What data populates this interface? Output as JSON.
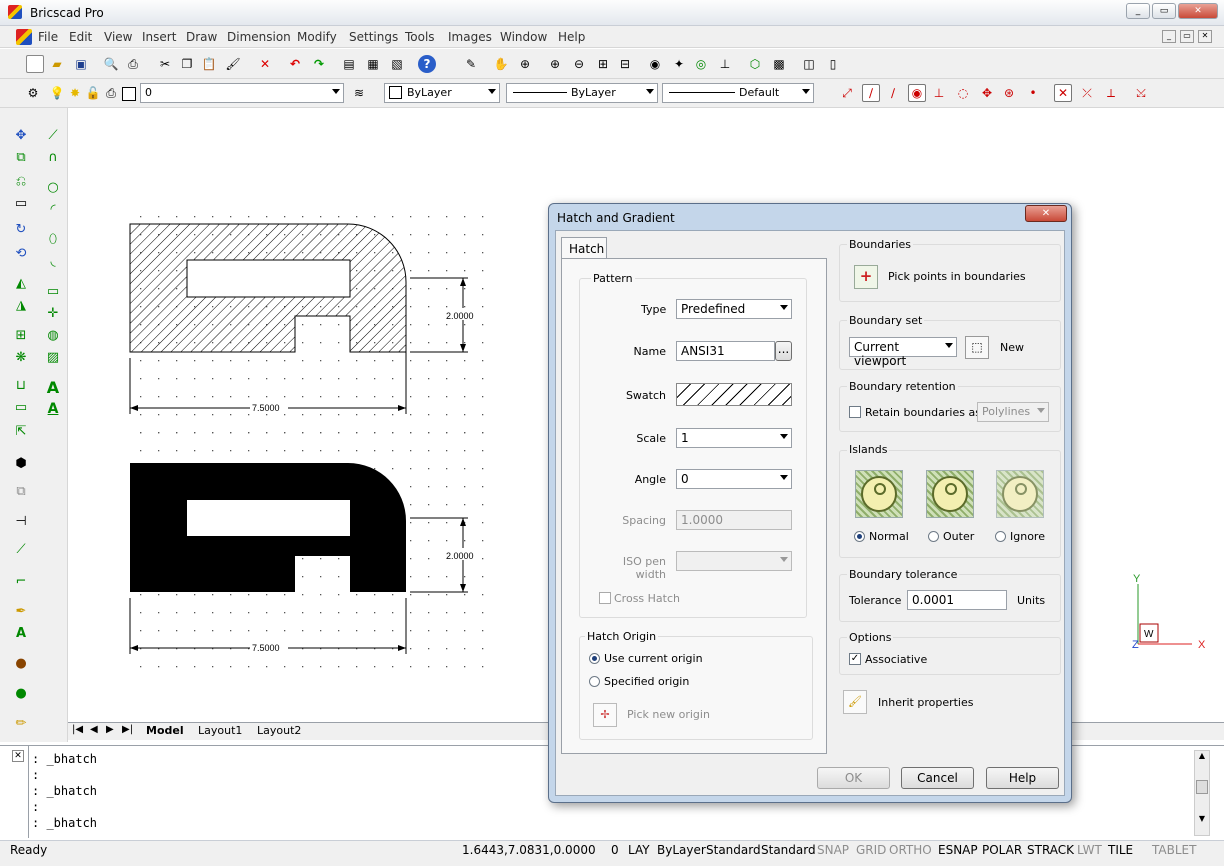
{
  "app": {
    "title": "Bricscad Pro"
  },
  "menu": [
    "File",
    "Edit",
    "View",
    "Insert",
    "Draw",
    "Dimension",
    "Modify",
    "Settings",
    "Tools",
    "Images",
    "Window",
    "Help"
  ],
  "props": {
    "layer": "0",
    "color": "ByLayer",
    "linetype": "ByLayer",
    "lineweight": "Default"
  },
  "drawing": {
    "dim_height_top": "2.0000",
    "dim_width_top": "7.5000",
    "dim_height_bottom": "2.0000",
    "dim_width_bottom": "7.5000"
  },
  "ucs": {
    "y": "Y",
    "x": "X",
    "z": "Z",
    "w": "W"
  },
  "layout_tabs": [
    "Model",
    "Layout1",
    "Layout2"
  ],
  "command_lines": [
    ": _bhatch",
    ":",
    ": _bhatch",
    ":",
    ": _bhatch"
  ],
  "status": {
    "ready": "Ready",
    "coords": "1.6443,7.0831,0.0000",
    "layer_num": "0",
    "items": [
      "LAY",
      "ByLayer",
      "Standard",
      "Standard",
      "SNAP",
      "GRID",
      "ORTHO",
      "ESNAP",
      "POLAR",
      "STRACK",
      "LWT",
      "TILE",
      "TABLET"
    ]
  },
  "dialog": {
    "title": "Hatch and Gradient",
    "tab": "Hatch",
    "pattern_group": "Pattern",
    "type_label": "Type",
    "type_value": "Predefined",
    "name_label": "Name",
    "name_value": "ANSI31",
    "browse": "...",
    "swatch_label": "Swatch",
    "scale_label": "Scale",
    "scale_value": "1",
    "angle_label": "Angle",
    "angle_value": "0",
    "spacing_label": "Spacing",
    "spacing_value": "1.0000",
    "iso_label": "ISO pen width",
    "cross_hatch": "Cross Hatch",
    "origin_group": "Hatch Origin",
    "use_current": "Use current origin",
    "specified": "Specified origin",
    "pick_origin": "Pick new origin",
    "boundaries_group": "Boundaries",
    "pick_points": "Pick points in boundaries",
    "boundary_set_group": "Boundary set",
    "boundary_set_value": "Current viewport",
    "new": "New",
    "retention_group": "Boundary retention",
    "retain": "Retain boundaries as",
    "retain_type": "Polylines",
    "islands_group": "Islands",
    "island_normal": "Normal",
    "island_outer": "Outer",
    "island_ignore": "Ignore",
    "tolerance_group": "Boundary tolerance",
    "tolerance_label": "Tolerance",
    "tolerance_value": "0.0001",
    "units": "Units",
    "options_group": "Options",
    "associative": "Associative",
    "inherit": "Inherit properties",
    "ok": "OK",
    "cancel": "Cancel",
    "help": "Help"
  }
}
